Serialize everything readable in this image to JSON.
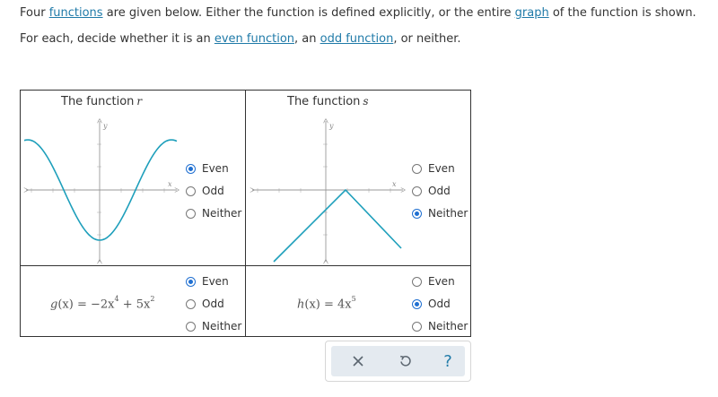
{
  "intro": {
    "line1_a": "Four ",
    "line1_link1": "functions",
    "line1_b": " are given below. Either the function is defined explicitly, or the entire ",
    "line1_link2": "graph",
    "line1_c": " of the function is shown.",
    "line2_a": "For each, decide whether it is an ",
    "line2_link1": "even function",
    "line2_b": ", an ",
    "line2_link2": "odd function",
    "line2_c": ", or neither."
  },
  "cells": {
    "r": {
      "title": "The function",
      "var": "r",
      "axis_x": "x",
      "axis_y": "y",
      "options": [
        "Even",
        "Odd",
        "Neither"
      ],
      "selected": "Even"
    },
    "s": {
      "title": "The function",
      "var": "s",
      "axis_x": "x",
      "axis_y": "y",
      "options": [
        "Even",
        "Odd",
        "Neither"
      ],
      "selected": "Neither"
    },
    "g": {
      "formula_lhs": "g",
      "formula_arg": "(x)",
      "formula_eq": " = −2x",
      "exp1": "4",
      "formula_mid": " + 5x",
      "exp2": "2",
      "options": [
        "Even",
        "Odd",
        "Neither"
      ],
      "selected": "Even"
    },
    "h": {
      "formula_lhs": "h",
      "formula_arg": "(x)",
      "formula_eq": " = 4x",
      "exp1": "5",
      "options": [
        "Even",
        "Odd",
        "Neither"
      ],
      "selected": "Odd"
    }
  },
  "toolbar": {
    "close_icon": "x-icon",
    "undo_icon": "undo-icon",
    "help_label": "?"
  },
  "colors": {
    "curve": "#1e9fbb",
    "radio_selected": "#1f6fd1",
    "link": "#1f7aa8",
    "axis": "#999999"
  }
}
